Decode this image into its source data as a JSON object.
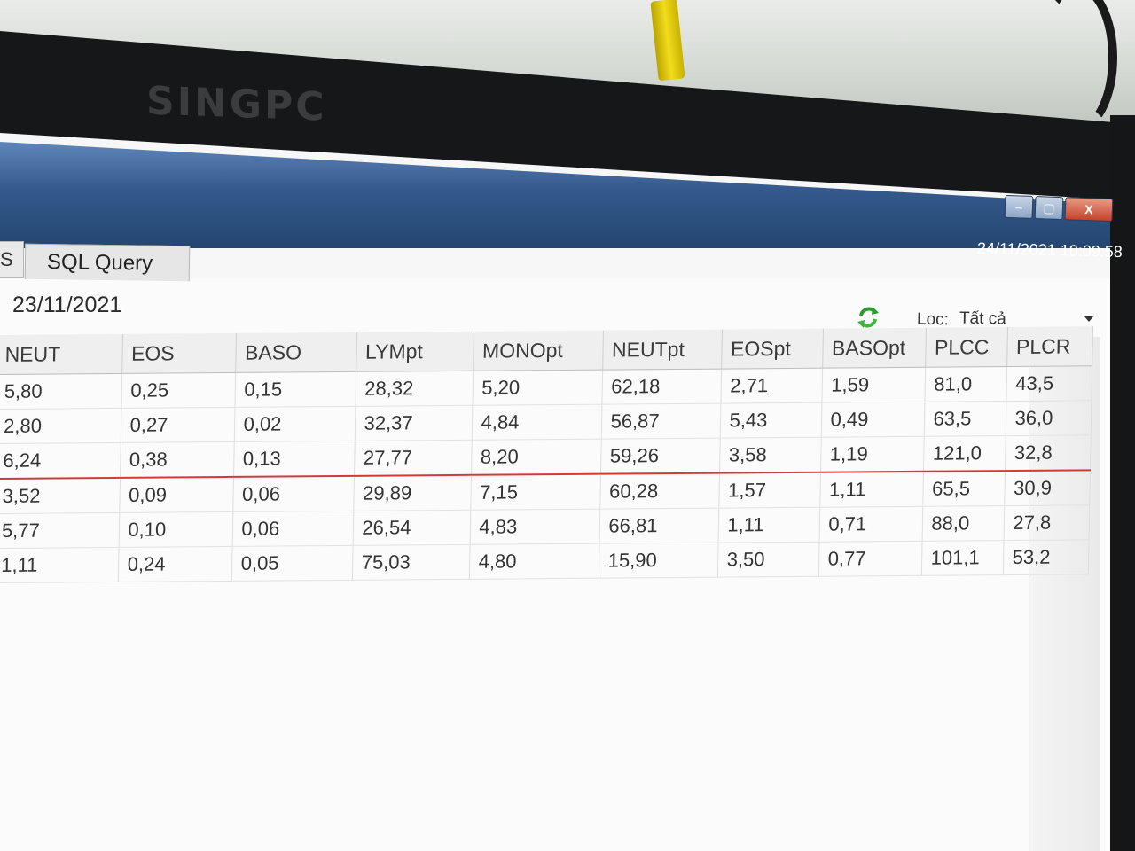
{
  "monitor": {
    "brand": "SINGPC"
  },
  "window": {
    "clock": "24/11/2021 10:09:58",
    "controls": {
      "minimize": "–",
      "maximize": "▢",
      "close": "X"
    }
  },
  "tabs": {
    "previous": "S",
    "active": "SQL Query"
  },
  "toolbar": {
    "date": "23/11/2021",
    "filter_label": "Loc:",
    "filter_value": "Tất cả"
  },
  "table": {
    "columns": [
      "NEUT",
      "EOS",
      "BASO",
      "LYMpt",
      "MONOpt",
      "NEUTpt",
      "EOSpt",
      "BASOpt",
      "PLCC",
      "PLCR"
    ],
    "rows": [
      [
        "5,80",
        "0,25",
        "0,15",
        "28,32",
        "5,20",
        "62,18",
        "2,71",
        "1,59",
        "81,0",
        "43,5"
      ],
      [
        "2,80",
        "0,27",
        "0,02",
        "32,37",
        "4,84",
        "56,87",
        "5,43",
        "0,49",
        "63,5",
        "36,0"
      ],
      [
        "6,24",
        "0,38",
        "0,13",
        "27,77",
        "8,20",
        "59,26",
        "3,58",
        "1,19",
        "121,0",
        "32,8"
      ],
      [
        "3,52",
        "0,09",
        "0,06",
        "29,89",
        "7,15",
        "60,28",
        "1,57",
        "1,11",
        "65,5",
        "30,9"
      ],
      [
        "5,77",
        "0,10",
        "0,06",
        "26,54",
        "4,83",
        "66,81",
        "1,11",
        "0,71",
        "88,0",
        "27,8"
      ],
      [
        "1,11",
        "0,24",
        "0,05",
        "75,03",
        "4,80",
        "15,90",
        "3,50",
        "0,77",
        "101,1",
        "53,2"
      ]
    ]
  }
}
